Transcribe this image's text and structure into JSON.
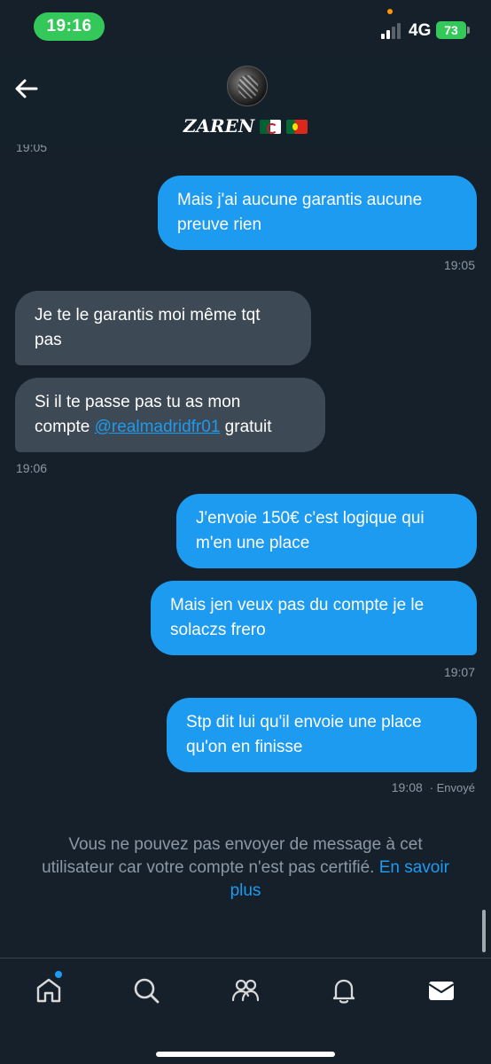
{
  "status_bar": {
    "time": "19:16",
    "network": "4G",
    "battery": "73"
  },
  "header": {
    "name": "ZAREN",
    "flags": [
      "algeria-flag",
      "portugal-flag"
    ],
    "cut_timestamp": "19:05"
  },
  "messages": [
    {
      "type": "sent",
      "text_lines": [
        "Mais j'ai aucune garantis aucune",
        "preuve rien"
      ]
    },
    {
      "type": "time",
      "text": "19:05"
    },
    {
      "type": "received",
      "text_lines": [
        "Je te le garantis moi même tqt",
        "pas"
      ]
    },
    {
      "type": "received",
      "line1": "Si il te passe pas tu as mon",
      "line2_prefix": "compte ",
      "mention": "@realmadridfr01",
      "line2_suffix": " gratuit"
    },
    {
      "type": "time",
      "text": "19:06"
    },
    {
      "type": "sent",
      "text_lines": [
        "J'envoie 150€ c'est logique qui",
        "m'en une place"
      ]
    },
    {
      "type": "sent",
      "text_lines": [
        "Mais jen veux pas du compte je le",
        "solaczs frero"
      ]
    },
    {
      "type": "time",
      "text": "19:07"
    },
    {
      "type": "sent",
      "text_lines": [
        "Stp dit lui qu'il envoie une place",
        "qu'on en finisse"
      ]
    },
    {
      "type": "time",
      "text": "19:08",
      "status": "· Envoyé"
    }
  ],
  "notice": {
    "line1": "Vous ne pouvez pas envoyer de message à cet",
    "line2": "utilisateur car votre compte n'est pas certifié.",
    "link_part1": "En savoir",
    "link_part2": "plus"
  },
  "nav": {
    "items": [
      "home-icon",
      "search-icon",
      "communities-icon",
      "notifications-icon",
      "messages-icon"
    ]
  },
  "colors": {
    "background": "#15202b",
    "sent_bubble": "#1d9bf0",
    "received_bubble": "#3d4955",
    "status_green": "#34c759"
  }
}
